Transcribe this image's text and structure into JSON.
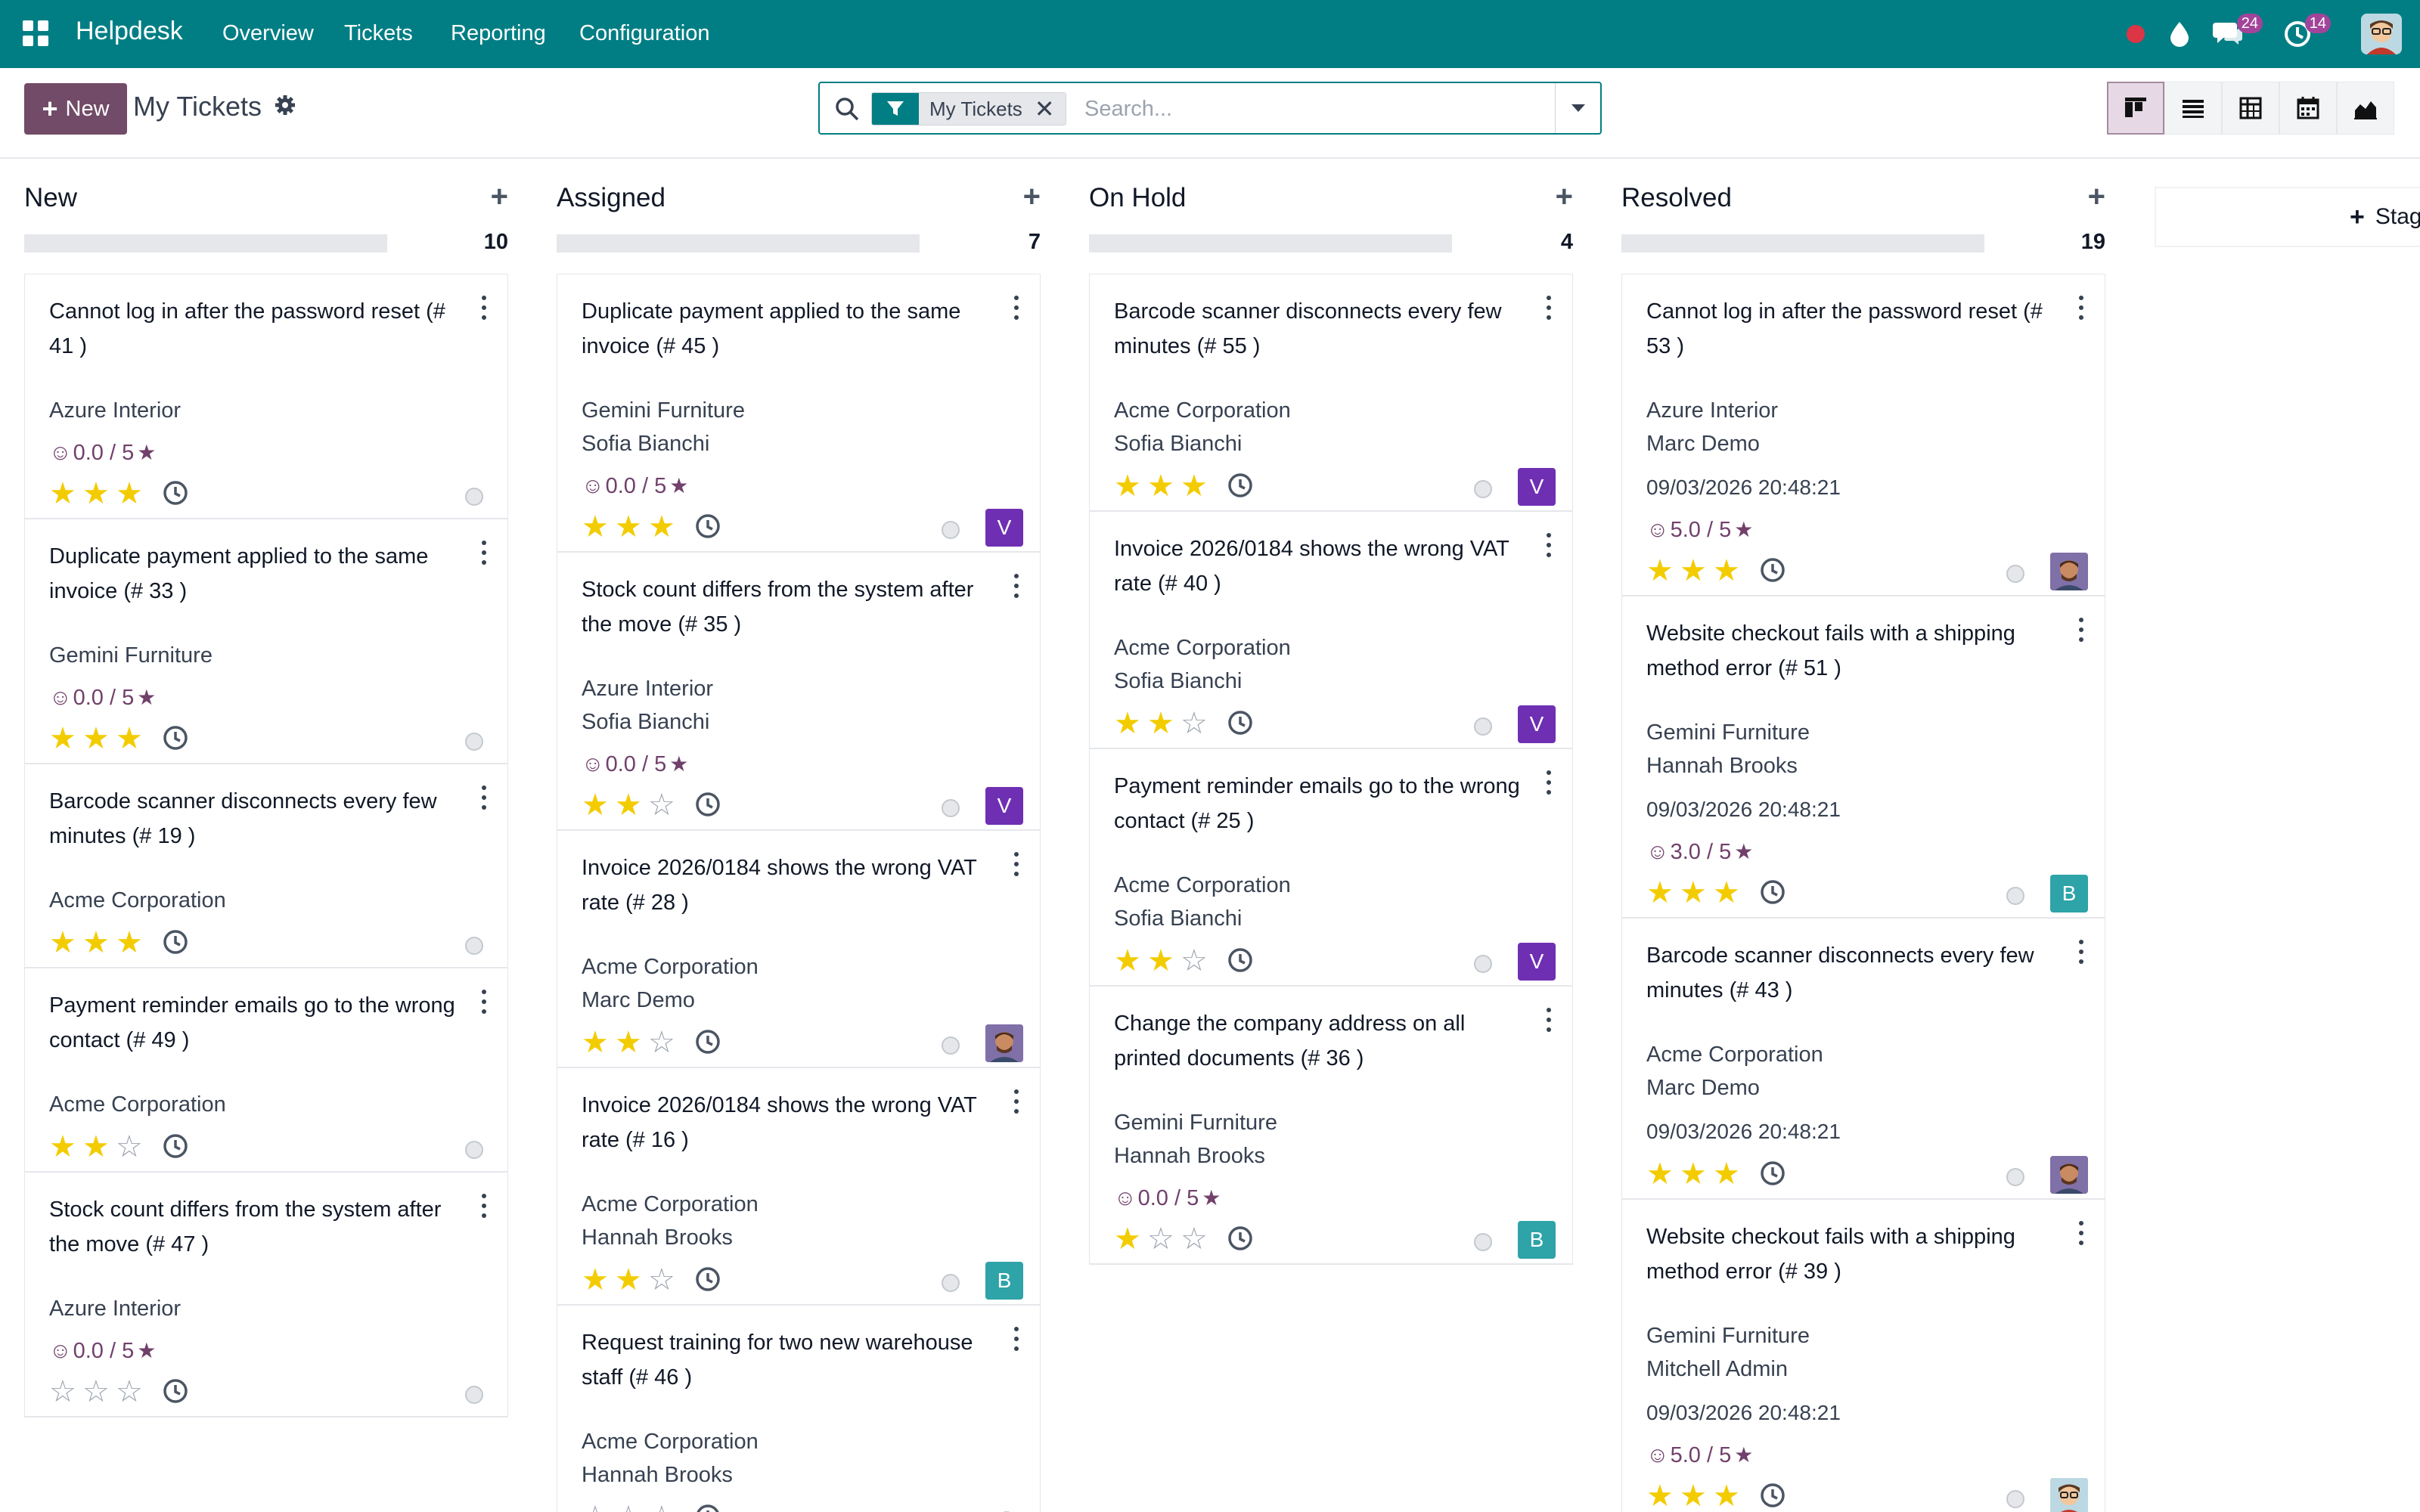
{
  "app": {
    "brand": "Helpdesk",
    "menu": [
      "Overview",
      "Tickets",
      "Reporting",
      "Configuration"
    ],
    "tray": {
      "messages_count": "24",
      "activities_count": "14"
    }
  },
  "control": {
    "new_label": "New",
    "title": "My Tickets",
    "facet_label": "My Tickets",
    "search_placeholder": "Search..."
  },
  "kanban": {
    "add_stage_label": "Stag",
    "columns": [
      {
        "title": "New",
        "count": "10",
        "cards": [
          {
            "title": "Cannot log in after the password reset (# 41 )",
            "lines": [
              "Azure Interior"
            ],
            "rating": "0.0 / 5",
            "stars": 3,
            "assignee": "none"
          },
          {
            "title": "Duplicate payment applied to the same invoice (# 33 )",
            "lines": [
              "Gemini Furniture"
            ],
            "rating": "0.0 / 5",
            "stars": 3,
            "assignee": "none"
          },
          {
            "title": "Barcode scanner disconnects every few minutes (# 19 )",
            "lines": [
              "Acme Corporation"
            ],
            "stars": 3,
            "assignee": "none"
          },
          {
            "title": "Payment reminder emails go to the wrong contact (# 49 )",
            "lines": [
              "Acme Corporation"
            ],
            "stars": 2,
            "assignee": "none"
          },
          {
            "title": "Stock count differs from the system after the move (# 47 )",
            "lines": [
              "Azure Interior"
            ],
            "rating": "0.0 / 5",
            "stars": 0,
            "assignee": "none"
          }
        ]
      },
      {
        "title": "Assigned",
        "count": "7",
        "cards": [
          {
            "title": "Duplicate payment applied to the same invoice (# 45 )",
            "lines": [
              "Gemini Furniture",
              "Sofia Bianchi"
            ],
            "rating": "0.0 / 5",
            "stars": 3,
            "assignee": "V"
          },
          {
            "title": "Stock count differs from the system after the move (# 35 )",
            "lines": [
              "Azure Interior",
              "Sofia Bianchi"
            ],
            "rating": "0.0 / 5",
            "stars": 2,
            "assignee": "V"
          },
          {
            "title": "Invoice 2026/0184 shows the wrong VAT rate (# 28 )",
            "lines": [
              "Acme Corporation",
              "Marc Demo"
            ],
            "stars": 2,
            "assignee": "photo"
          },
          {
            "title": "Invoice 2026/0184 shows the wrong VAT rate (# 16 )",
            "lines": [
              "Acme Corporation",
              "Hannah Brooks"
            ],
            "stars": 2,
            "assignee": "B"
          },
          {
            "title": "Request training for two new warehouse staff (# 46 )",
            "lines": [
              "Acme Corporation",
              "Hannah Brooks"
            ],
            "stars": 0,
            "assignee": "none"
          }
        ]
      },
      {
        "title": "On Hold",
        "count": "4",
        "cards": [
          {
            "title": "Barcode scanner disconnects every few minutes (# 55 )",
            "lines": [
              "Acme Corporation",
              "Sofia Bianchi"
            ],
            "stars": 3,
            "assignee": "V"
          },
          {
            "title": "Invoice 2026/0184 shows the wrong VAT rate (# 40 )",
            "lines": [
              "Acme Corporation",
              "Sofia Bianchi"
            ],
            "stars": 2,
            "assignee": "V"
          },
          {
            "title": "Payment reminder emails go to the wrong contact (# 25 )",
            "lines": [
              "Acme Corporation",
              "Sofia Bianchi"
            ],
            "stars": 2,
            "assignee": "V"
          },
          {
            "title": "Change the company address on all printed documents (# 36 )",
            "lines": [
              "Gemini Furniture",
              "Hannah Brooks"
            ],
            "rating": "0.0 / 5",
            "stars": 1,
            "assignee": "B"
          }
        ]
      },
      {
        "title": "Resolved",
        "count": "19",
        "cards": [
          {
            "title": "Cannot log in after the password reset (# 53 )",
            "lines": [
              "Azure Interior",
              "Marc Demo"
            ],
            "date": "09/03/2026 20:48:21",
            "rating": "5.0 / 5",
            "stars": 3,
            "assignee": "photo"
          },
          {
            "title": "Website checkout fails with a shipping method error (# 51 )",
            "lines": [
              "Gemini Furniture",
              "Hannah Brooks"
            ],
            "date": "09/03/2026 20:48:21",
            "rating": "3.0 / 5",
            "stars": 3,
            "assignee": "B"
          },
          {
            "title": "Barcode scanner disconnects every few minutes (# 43 )",
            "lines": [
              "Acme Corporation",
              "Marc Demo"
            ],
            "date": "09/03/2026 20:48:21",
            "stars": 3,
            "assignee": "photo"
          },
          {
            "title": "Website checkout fails with a shipping method error (# 39 )",
            "lines": [
              "Gemini Furniture",
              "Mitchell Admin"
            ],
            "date": "09/03/2026 20:48:21",
            "rating": "5.0 / 5",
            "stars": 3,
            "assignee": "admin"
          }
        ]
      }
    ]
  }
}
